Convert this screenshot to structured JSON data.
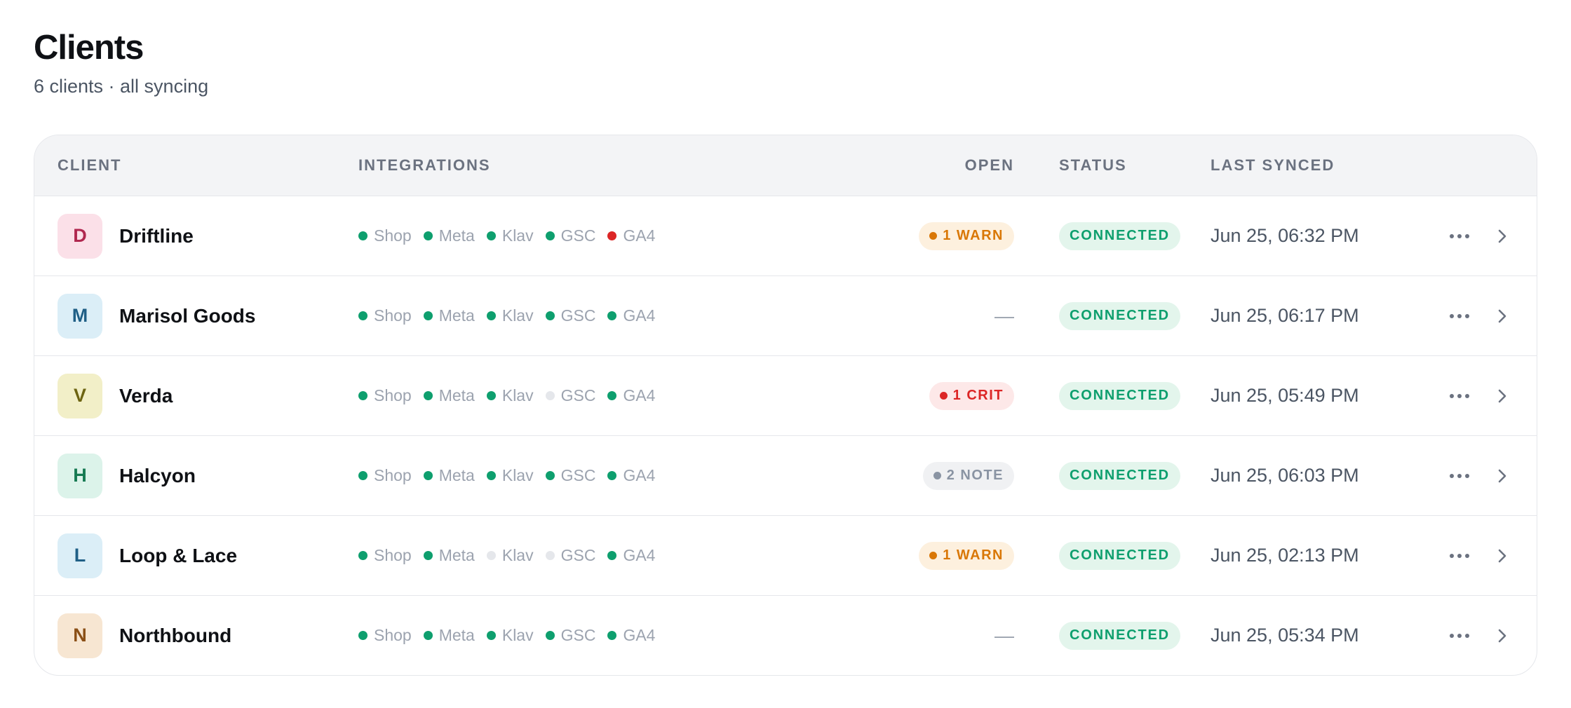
{
  "page": {
    "title": "Clients",
    "subtitle": "6 clients · all syncing"
  },
  "table": {
    "headers": {
      "client": "CLIENT",
      "integrations": "INTEGRATIONS",
      "open": "OPEN",
      "status": "STATUS",
      "last_synced": "LAST SYNCED"
    },
    "rows": [
      {
        "initial": "D",
        "name": "Driftline",
        "avatar_bg": "#fbe0e8",
        "avatar_fg": "#b0284f",
        "integrations": [
          {
            "label": "Shop",
            "color": "#0e9f6e"
          },
          {
            "label": "Meta",
            "color": "#0e9f6e"
          },
          {
            "label": "Klav",
            "color": "#0e9f6e"
          },
          {
            "label": "GSC",
            "color": "#0e9f6e"
          },
          {
            "label": "GA4",
            "color": "#dc2626"
          }
        ],
        "open": {
          "text": "1 WARN",
          "kind": "warn"
        },
        "status": "CONNECTED",
        "last_synced": "Jun 25, 06:32 PM"
      },
      {
        "initial": "M",
        "name": "Marisol Goods",
        "avatar_bg": "#dbeef7",
        "avatar_fg": "#1f5f86",
        "integrations": [
          {
            "label": "Shop",
            "color": "#0e9f6e"
          },
          {
            "label": "Meta",
            "color": "#0e9f6e"
          },
          {
            "label": "Klav",
            "color": "#0e9f6e"
          },
          {
            "label": "GSC",
            "color": "#0e9f6e"
          },
          {
            "label": "GA4",
            "color": "#0e9f6e"
          }
        ],
        "open": {
          "text": "—",
          "kind": "none"
        },
        "status": "CONNECTED",
        "last_synced": "Jun 25, 06:17 PM"
      },
      {
        "initial": "V",
        "name": "Verda",
        "avatar_bg": "#f2efc8",
        "avatar_fg": "#6d6412",
        "integrations": [
          {
            "label": "Shop",
            "color": "#0e9f6e"
          },
          {
            "label": "Meta",
            "color": "#0e9f6e"
          },
          {
            "label": "Klav",
            "color": "#0e9f6e"
          },
          {
            "label": "GSC",
            "color": "#e5e7eb"
          },
          {
            "label": "GA4",
            "color": "#0e9f6e"
          }
        ],
        "open": {
          "text": "1 CRIT",
          "kind": "crit"
        },
        "status": "CONNECTED",
        "last_synced": "Jun 25, 05:49 PM"
      },
      {
        "initial": "H",
        "name": "Halcyon",
        "avatar_bg": "#dcf3ea",
        "avatar_fg": "#167a52",
        "integrations": [
          {
            "label": "Shop",
            "color": "#0e9f6e"
          },
          {
            "label": "Meta",
            "color": "#0e9f6e"
          },
          {
            "label": "Klav",
            "color": "#0e9f6e"
          },
          {
            "label": "GSC",
            "color": "#0e9f6e"
          },
          {
            "label": "GA4",
            "color": "#0e9f6e"
          }
        ],
        "open": {
          "text": "2 NOTE",
          "kind": "note"
        },
        "status": "CONNECTED",
        "last_synced": "Jun 25, 06:03 PM"
      },
      {
        "initial": "L",
        "name": "Loop & Lace",
        "avatar_bg": "#dbeef7",
        "avatar_fg": "#1f5f86",
        "integrations": [
          {
            "label": "Shop",
            "color": "#0e9f6e"
          },
          {
            "label": "Meta",
            "color": "#0e9f6e"
          },
          {
            "label": "Klav",
            "color": "#e5e7eb"
          },
          {
            "label": "GSC",
            "color": "#e5e7eb"
          },
          {
            "label": "GA4",
            "color": "#0e9f6e"
          }
        ],
        "open": {
          "text": "1 WARN",
          "kind": "warn"
        },
        "status": "CONNECTED",
        "last_synced": "Jun 25, 02:13 PM"
      },
      {
        "initial": "N",
        "name": "Northbound",
        "avatar_bg": "#f7e6d2",
        "avatar_fg": "#8a4f16",
        "integrations": [
          {
            "label": "Shop",
            "color": "#0e9f6e"
          },
          {
            "label": "Meta",
            "color": "#0e9f6e"
          },
          {
            "label": "Klav",
            "color": "#0e9f6e"
          },
          {
            "label": "GSC",
            "color": "#0e9f6e"
          },
          {
            "label": "GA4",
            "color": "#0e9f6e"
          }
        ],
        "open": {
          "text": "—",
          "kind": "none"
        },
        "status": "CONNECTED",
        "last_synced": "Jun 25, 05:34 PM"
      }
    ]
  },
  "badge_styles": {
    "warn": {
      "bg": "#fdf0de",
      "fg": "#d97706",
      "dot": "#d97706"
    },
    "crit": {
      "bg": "#fde8e8",
      "fg": "#dc2626",
      "dot": "#dc2626"
    },
    "note": {
      "bg": "#f0f1f3",
      "fg": "#8a94a3",
      "dot": "#8a94a3"
    }
  },
  "icons": {
    "more": "more-horizontal-icon",
    "chevron": "chevron-right-icon"
  }
}
